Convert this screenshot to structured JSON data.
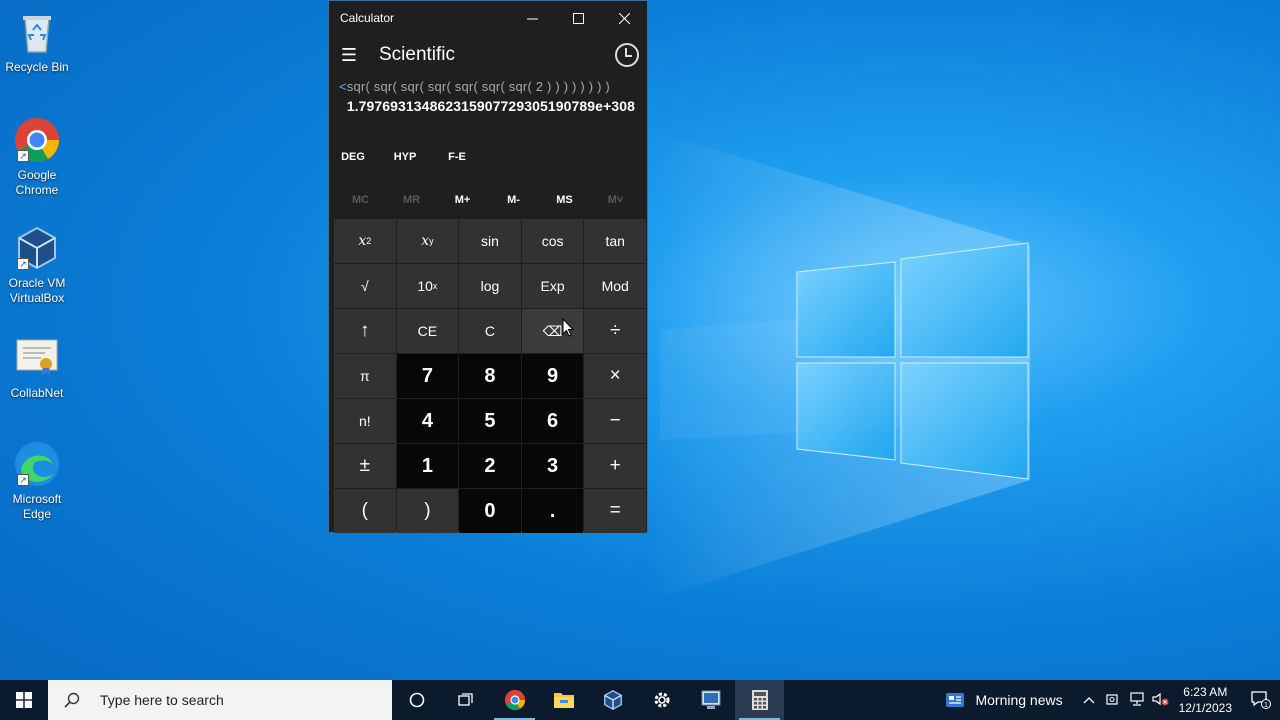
{
  "desktop": {
    "icons": [
      {
        "label": "Recycle Bin"
      },
      {
        "label": "Google Chrome"
      },
      {
        "label": "Oracle VM VirtualBox"
      },
      {
        "label": "CollabNet"
      },
      {
        "label": "Microsoft Edge"
      }
    ]
  },
  "calculator": {
    "window_title": "Calculator",
    "mode": "Scientific",
    "expression_scroll": "<",
    "expression": "sqr( sqr( sqr( sqr( sqr( sqr( sqr( 2 ) ) ) ) ) ) ) )",
    "result": "1.797693134862315907729305190789e+308",
    "modes": [
      "DEG",
      "HYP",
      "F-E"
    ],
    "memory": [
      "MC",
      "MR",
      "M+",
      "M-",
      "MS",
      "M˅"
    ],
    "keys": {
      "x2": "x",
      "x2_sup": "2",
      "xy": "x",
      "xy_sup": "y",
      "sin": "sin",
      "cos": "cos",
      "tan": "tan",
      "sqrt": "√",
      "tenx": "10",
      "tenx_sup": "x",
      "log": "log",
      "exp": "Exp",
      "mod": "Mod",
      "shift": "↑",
      "ce": "CE",
      "c": "C",
      "back": "⌫",
      "div": "÷",
      "pi": "π",
      "n7": "7",
      "n8": "8",
      "n9": "9",
      "mul": "×",
      "fact": "n!",
      "n4": "4",
      "n5": "5",
      "n6": "6",
      "sub": "−",
      "neg": "±",
      "n1": "1",
      "n2": "2",
      "n3": "3",
      "add": "+",
      "lparen": "(",
      "rparen": ")",
      "n0": "0",
      "dot": ".",
      "eq": "="
    }
  },
  "taskbar": {
    "search_placeholder": "Type here to search",
    "news": "Morning news",
    "time": "6:23 AM",
    "date": "12/1/2023",
    "notification_count": "1"
  },
  "colors": {
    "accent": "#76b9ed",
    "calc_bg": "#1f1f1f",
    "key_bg": "#323232",
    "num_key_bg": "#070707"
  }
}
